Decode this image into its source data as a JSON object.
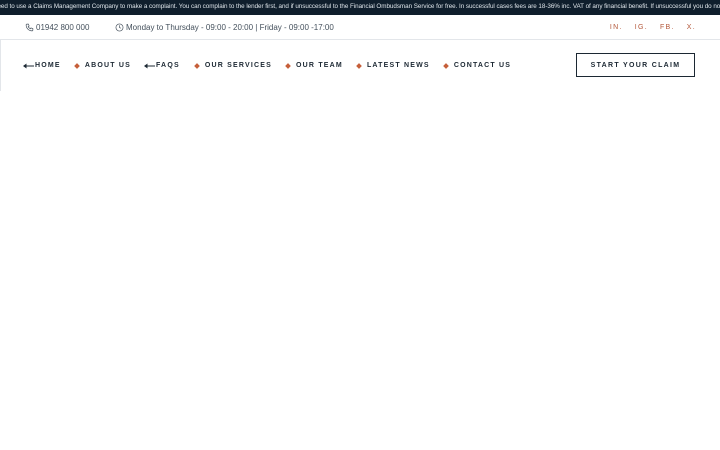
{
  "ticker": {
    "text": "need to use a Claims Management Company to make a complaint. You can complain to the lender first, and if unsuccessful to the Financial Ombudsman Service for free. In successful cases fees are 18-36% inc. VAT of any financial benefit. If unsuccessful you do not pay a penny."
  },
  "topbar": {
    "phone": "01942 800 000",
    "hours": "Monday to Thursday - 09:00 - 20:00 | Friday - 09:00 -17:00",
    "socials": [
      "IN.",
      "IG.",
      "FB.",
      "X."
    ]
  },
  "nav": {
    "items": [
      "HOME",
      "ABOUT US",
      "FAQS",
      "OUR SERVICES",
      "OUR TEAM",
      "LATEST NEWS",
      "CONTACT US"
    ]
  },
  "cta": {
    "label": "START YOUR CLAIM"
  },
  "colors": {
    "ticker_bg": "#0f1e2c",
    "accent": "#c65f3a",
    "text": "#1c2833"
  }
}
